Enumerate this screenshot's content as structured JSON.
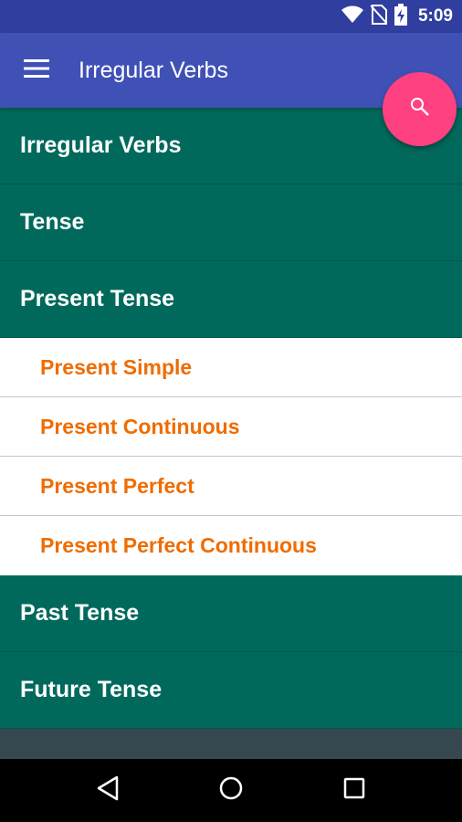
{
  "status_bar": {
    "time": "5:09"
  },
  "app_bar": {
    "title": "Irregular Verbs"
  },
  "menu": {
    "sections_top": [
      {
        "label": "Irregular Verbs"
      },
      {
        "label": "Tense"
      },
      {
        "label": "Present Tense"
      }
    ],
    "present_items": [
      {
        "label": "Present Simple"
      },
      {
        "label": "Present Continuous"
      },
      {
        "label": "Present Perfect"
      },
      {
        "label": "Present Perfect Continuous"
      }
    ],
    "sections_bottom": [
      {
        "label": "Past Tense"
      },
      {
        "label": "Future Tense"
      }
    ]
  },
  "colors": {
    "status_bar": "#303f9f",
    "app_bar": "#3f51b5",
    "section_bg": "#00695c",
    "sub_item_text": "#ef6c00",
    "fab": "#ff4081",
    "background": "#37474f"
  },
  "icons": {
    "menu": "hamburger-icon",
    "fab": "search-icon",
    "status": [
      "wifi-icon",
      "no-sim-icon",
      "battery-charging-icon"
    ],
    "nav": [
      "back-icon",
      "home-icon",
      "recents-icon"
    ]
  }
}
